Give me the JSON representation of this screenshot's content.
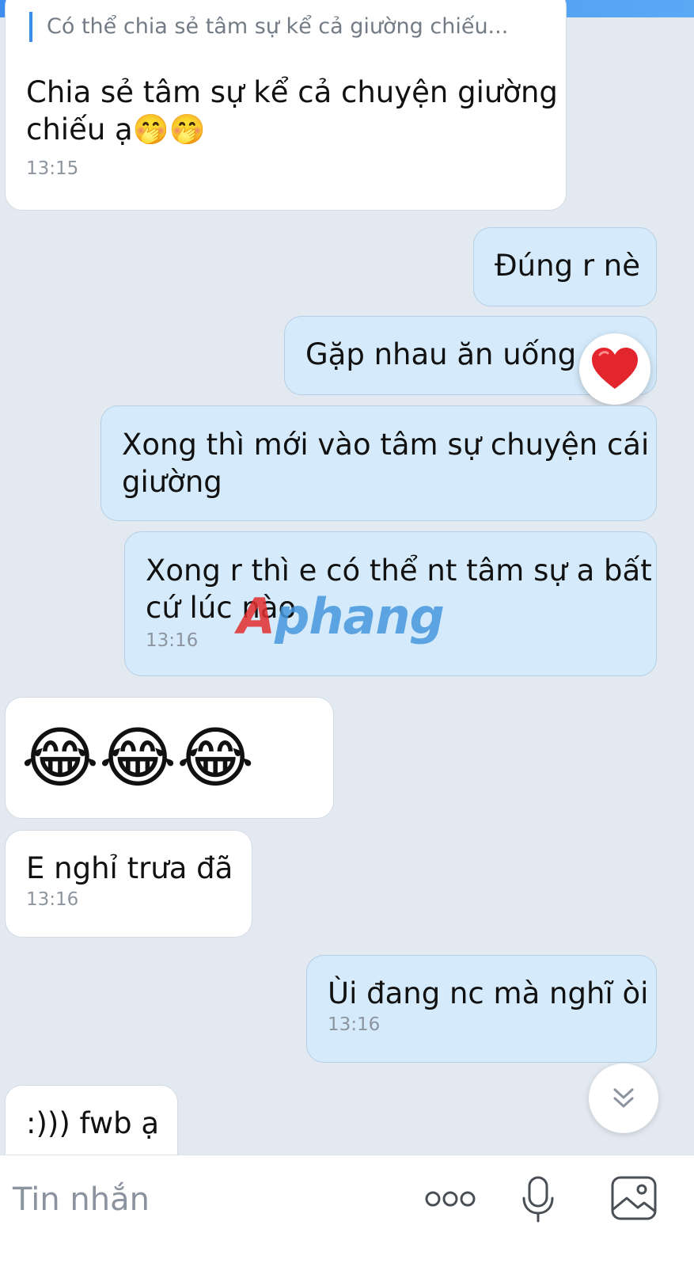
{
  "messages": [
    {
      "direction": "incoming",
      "reply_quote": "Có thể chia sẻ tâm sự kể cả giường chiếu...",
      "text_line1": "Chia sẻ tâm sự kể cả chuyện giường",
      "text_line2": "chiếu ạ",
      "emoji": "🤭🤭",
      "time": "13:15"
    },
    {
      "direction": "outgoing",
      "text": "Đúng r nè"
    },
    {
      "direction": "outgoing",
      "text": "Gặp nhau ăn uống r",
      "reaction": "heart-reaction"
    },
    {
      "direction": "outgoing",
      "text_line1": "Xong thì mới vào tâm sự chuyện cái",
      "text_line2": "giường"
    },
    {
      "direction": "outgoing",
      "text_line1": "Xong r thì e có thể nt tâm sự a bất",
      "text_line2": "cứ lúc nào",
      "time": "13:16"
    },
    {
      "direction": "incoming",
      "emoji": "😂😂😂"
    },
    {
      "direction": "incoming",
      "text": "E nghỉ trưa đã",
      "time": "13:16"
    },
    {
      "direction": "outgoing",
      "text": "Ùi đang nc mà nghĩ òi",
      "time": "13:16"
    },
    {
      "direction": "incoming",
      "text": ":))) fwb ạ"
    }
  ],
  "watermark": {
    "first": "A",
    "rest": "phang"
  },
  "composer": {
    "placeholder": "Tin nhắn",
    "icons": [
      "more-icon",
      "microphone-icon",
      "image-icon"
    ]
  },
  "scroll_down_icon": "chevron-double-down-icon",
  "colors": {
    "background": "#e2e9f1",
    "incoming_bubble": "#ffffff",
    "outgoing_bubble": "#d5ebfb",
    "accent": "#3a8ee8",
    "timestamp": "#8c959f"
  }
}
